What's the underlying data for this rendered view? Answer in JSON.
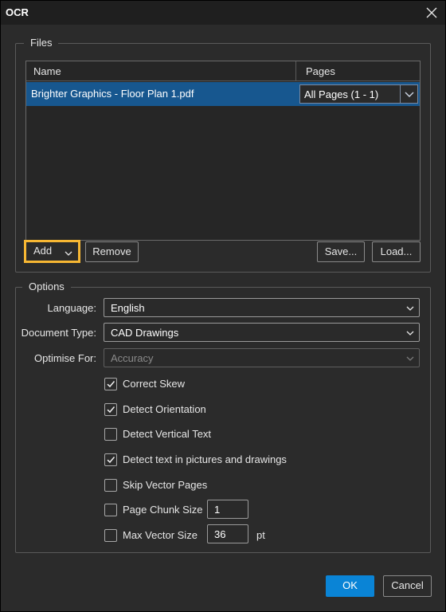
{
  "window": {
    "title": "OCR"
  },
  "files": {
    "group_title": "Files",
    "columns": {
      "name": "Name",
      "pages": "Pages"
    },
    "rows": [
      {
        "name": "Brighter Graphics - Floor Plan 1.pdf",
        "pages": "All Pages (1 - 1)"
      }
    ],
    "buttons": {
      "add": "Add",
      "remove": "Remove",
      "save": "Save...",
      "load": "Load..."
    }
  },
  "options": {
    "group_title": "Options",
    "language": {
      "label": "Language:",
      "value": "English"
    },
    "document_type": {
      "label": "Document Type:",
      "value": "CAD Drawings"
    },
    "optimise_for": {
      "label": "Optimise For:",
      "value": "Accuracy",
      "disabled": true
    },
    "checkboxes": [
      {
        "label": "Correct Skew",
        "checked": true
      },
      {
        "label": "Detect Orientation",
        "checked": true
      },
      {
        "label": "Detect Vertical Text",
        "checked": false
      },
      {
        "label": "Detect text in pictures and drawings",
        "checked": true
      },
      {
        "label": "Skip Vector Pages",
        "checked": false
      },
      {
        "label": "Page Chunk Size",
        "checked": false,
        "value": "1"
      },
      {
        "label": "Max Vector Size",
        "checked": false,
        "value": "36",
        "unit": "pt"
      }
    ]
  },
  "footer": {
    "ok": "OK",
    "cancel": "Cancel"
  },
  "colors": {
    "accent": "#0a84d6",
    "highlight": "#f7b733",
    "selection": "#17578f"
  }
}
